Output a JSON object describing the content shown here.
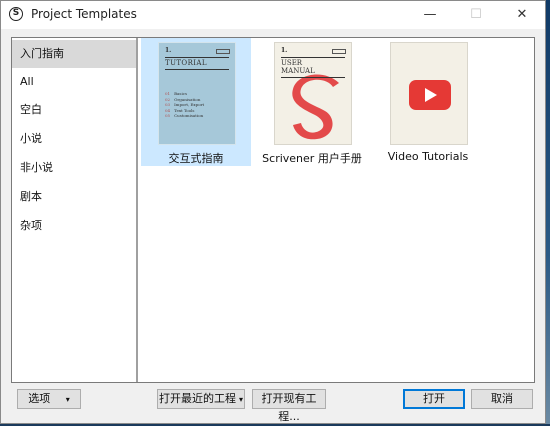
{
  "window": {
    "title": "Project Templates",
    "app_icon_glyph": "S",
    "minimize_glyph": "—",
    "maximize_glyph": "☐",
    "close_glyph": "✕"
  },
  "sidebar": {
    "items": [
      {
        "label": "入门指南",
        "selected": true
      },
      {
        "label": "All",
        "selected": false
      },
      {
        "label": "空白",
        "selected": false
      },
      {
        "label": "小说",
        "selected": false
      },
      {
        "label": "非小说",
        "selected": false
      },
      {
        "label": "剧本",
        "selected": false
      },
      {
        "label": "杂项",
        "selected": false
      }
    ]
  },
  "templates": [
    {
      "label": "交互式指南",
      "selected": true,
      "thumb": {
        "number": "1.",
        "heading": "TUTORIAL",
        "list": [
          {
            "n": "01",
            "t": "Basics"
          },
          {
            "n": "02",
            "t": "Organisation"
          },
          {
            "n": "03",
            "t": "Import, Export"
          },
          {
            "n": "04",
            "t": "Text Tools"
          },
          {
            "n": "05",
            "t": "Customisation"
          }
        ]
      }
    },
    {
      "label": "Scrivener 用户手册",
      "selected": false,
      "thumb": {
        "number": "1.",
        "heading_line1": "USER",
        "heading_line2": "MANUAL"
      }
    },
    {
      "label": "Video Tutorials",
      "selected": false,
      "thumb": {
        "icon": "youtube-play-icon"
      }
    }
  ],
  "footer": {
    "options_label": "选项",
    "open_recent_label": "打开最近的工程",
    "open_existing_label": "打开现有工程...",
    "open_label": "打开",
    "cancel_label": "取消",
    "dropdown_glyph": "▾"
  },
  "colors": {
    "selected_tile": "#cce8ff",
    "selected_sidebar": "#d9d9d9",
    "tutorial_cover": "#a6c8d9",
    "manual_accent": "#e34a4a",
    "youtube_red": "#e53935",
    "default_button_border": "#0078d7"
  }
}
